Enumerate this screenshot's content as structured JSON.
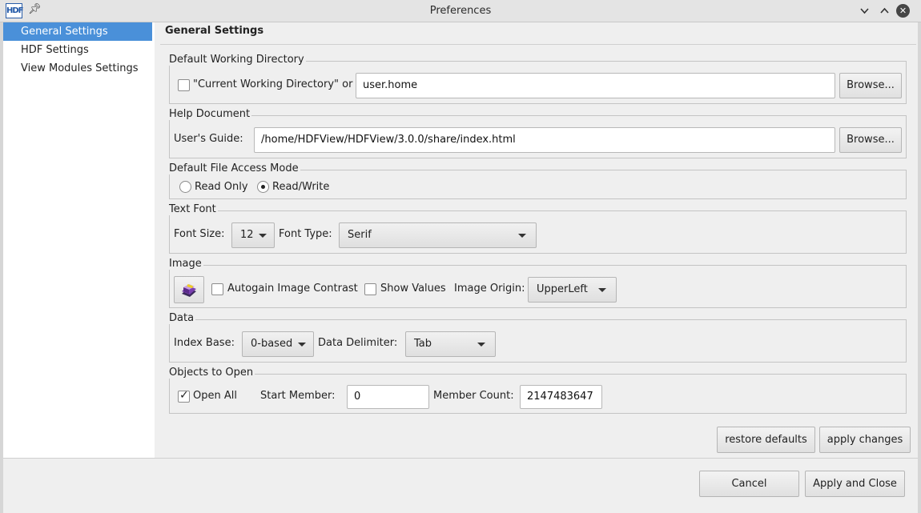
{
  "window": {
    "title": "Preferences",
    "app_icon_text": "HDF"
  },
  "sidebar": {
    "items": [
      {
        "label": "General Settings",
        "selected": true
      },
      {
        "label": "HDF Settings",
        "selected": false
      },
      {
        "label": "View Modules Settings",
        "selected": false
      }
    ]
  },
  "page": {
    "title": "General Settings"
  },
  "working_dir": {
    "legend": "Default Working Directory",
    "checkbox_label": "\"Current Working Directory\" or",
    "checked": false,
    "value": "user.home",
    "browse_label": "Browse..."
  },
  "help_doc": {
    "legend": "Help Document",
    "label": "User's Guide:",
    "value": "/home/HDFView/HDFView/3.0.0/share/index.html",
    "browse_label": "Browse..."
  },
  "access_mode": {
    "legend": "Default File Access Mode",
    "options": [
      {
        "label": "Read Only",
        "selected": false
      },
      {
        "label": "Read/Write",
        "selected": true
      }
    ]
  },
  "text_font": {
    "legend": "Text Font",
    "size_label": "Font Size:",
    "size_value": "12",
    "type_label": "Font Type:",
    "type_value": "Serif"
  },
  "image": {
    "legend": "Image",
    "icon": "palette-book-icon",
    "autogain_label": "Autogain Image Contrast",
    "autogain_checked": false,
    "show_values_label": "Show Values",
    "show_values_checked": false,
    "origin_label": "Image Origin:",
    "origin_value": "UpperLeft"
  },
  "data": {
    "legend": "Data",
    "index_base_label": "Index Base:",
    "index_base_value": "0-based",
    "delimiter_label": "Data Delimiter:",
    "delimiter_value": "Tab"
  },
  "objects": {
    "legend": "Objects to Open",
    "open_all_label": "Open All",
    "open_all_checked": true,
    "start_label": "Start Member:",
    "start_value": "0",
    "count_label": "Member Count:",
    "count_value": "2147483647"
  },
  "actions": {
    "restore_label": "restore defaults",
    "apply_label": "apply changes",
    "cancel_label": "Cancel",
    "apply_close_label": "Apply and Close"
  }
}
